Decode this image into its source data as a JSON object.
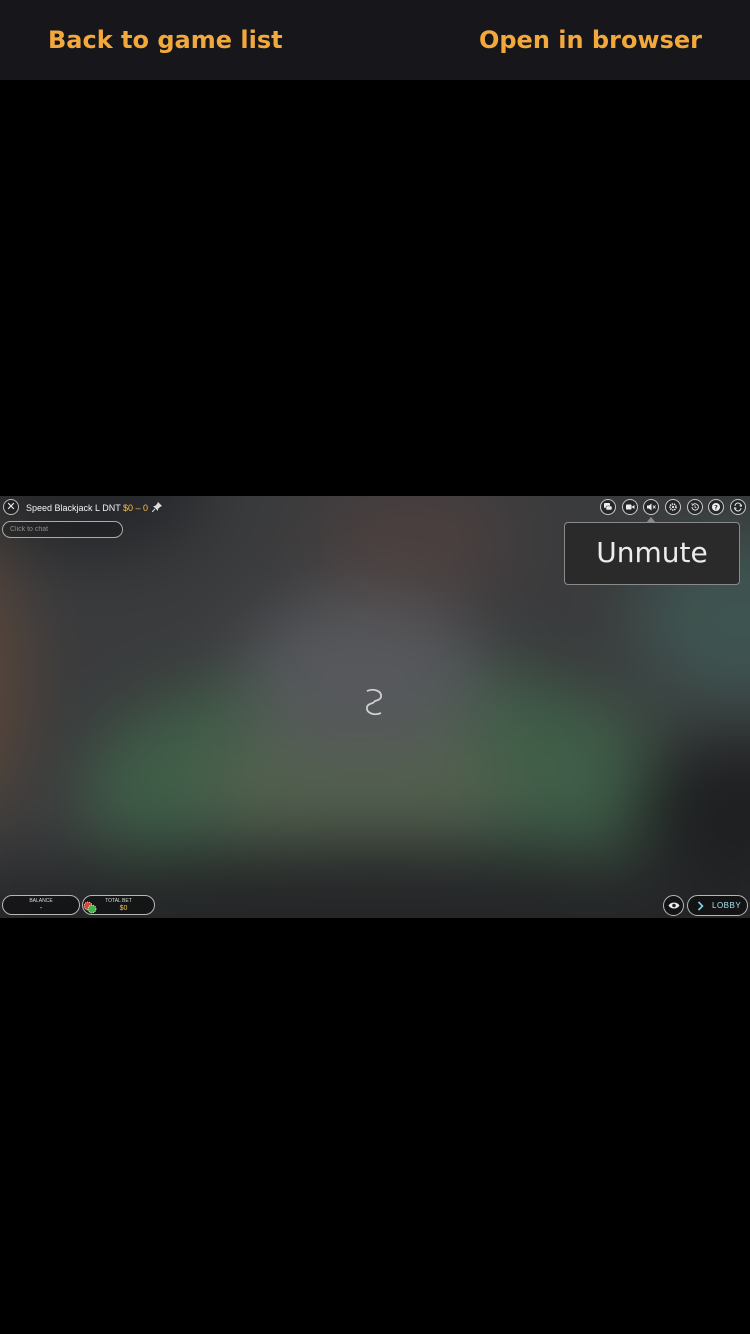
{
  "top_bar": {
    "back_label": "Back to game list",
    "open_label": "Open in browser",
    "accent_color": "#f3a83c"
  },
  "game": {
    "title": "Speed Blackjack L DNT",
    "bet_limits": "$0 – 0",
    "chat_placeholder": "Click to chat",
    "controls": [
      "chat-icon",
      "video-icon",
      "sound-muted-icon",
      "settings-icon",
      "history-icon",
      "help-icon",
      "fullscreen-icon"
    ],
    "tooltip": "Unmute",
    "balance": {
      "label": "BALANCE",
      "value": "-"
    },
    "total_bet": {
      "label": "TOTAL BET",
      "value": "$0"
    },
    "lobby_label": "LOBBY"
  }
}
